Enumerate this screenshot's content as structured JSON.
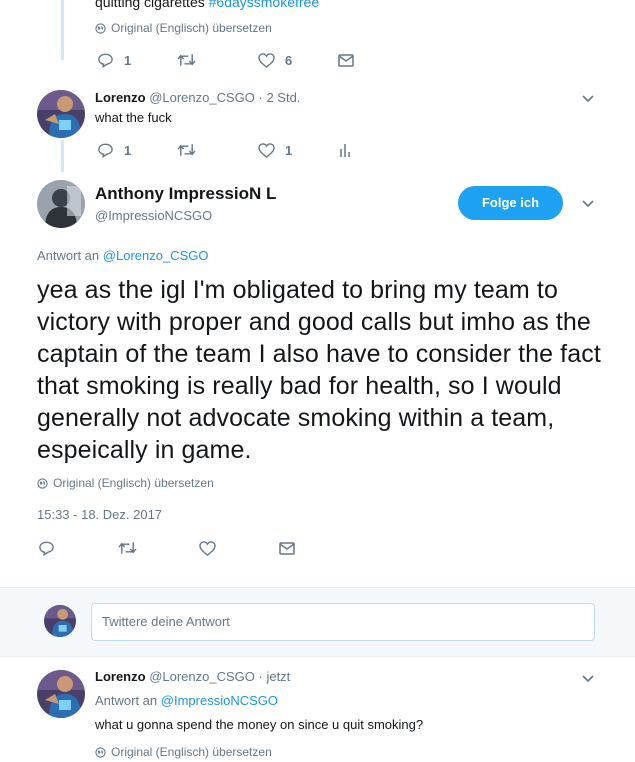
{
  "top_tweet": {
    "text_tail": "quitting cigarettes",
    "hashtag": "#6dayssmokefree",
    "translate": "Original (Englisch) übersetzen",
    "reply_count": "1",
    "like_count": "6"
  },
  "reply1": {
    "name": "Lorenzo",
    "handle": "@Lorenzo_CSGO",
    "time": "· 2 Std.",
    "text": "what the fuck",
    "reply_count": "1",
    "like_count": "1"
  },
  "main_tweet": {
    "name": "Anthony ImpressioN L",
    "handle": "@ImpressioNCSGO",
    "follow_label": "Folge ich",
    "reply_prefix": "Antwort an",
    "reply_to": "@Lorenzo_CSGO",
    "text": "yea as the igl I'm obligated to bring my team to victory with proper and good calls but imho as the captain of the team I also have to consider the fact that smoking is really bad for health, so I would generally not advocate smoking within a team, espeically in game.",
    "translate": "Original (Englisch) übersetzen",
    "timestamp": "15:33 - 18. Dez. 2017"
  },
  "compose": {
    "placeholder": "Twittere deine Antwort"
  },
  "reply2": {
    "name": "Lorenzo",
    "handle": "@Lorenzo_CSGO",
    "time": "· jetzt",
    "reply_prefix": "Antwort an",
    "reply_to": "@ImpressioNCSGO",
    "text": "what u gonna spend the money on since u quit smoking?",
    "translate": "Original (Englisch) übersetzen"
  },
  "colors": {
    "accent": "#1da1f2",
    "link": "#1b95e0",
    "muted": "#657786",
    "divider": "#e6ecf0"
  }
}
